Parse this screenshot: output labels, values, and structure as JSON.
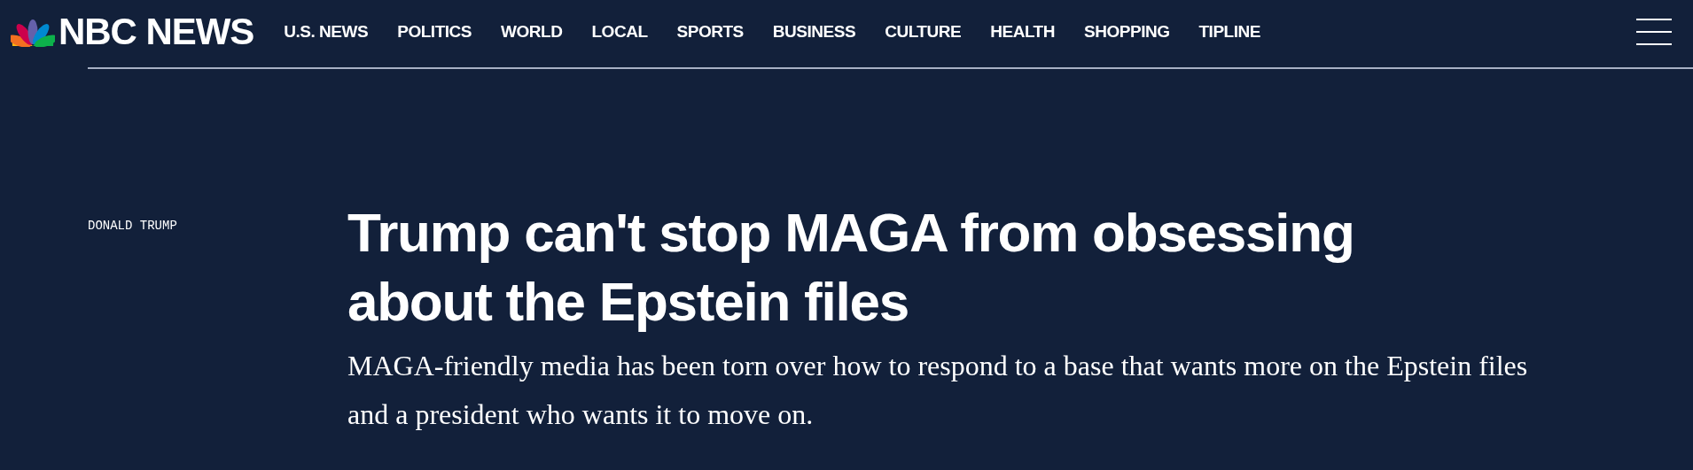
{
  "header": {
    "logo_text": "NBC NEWS",
    "nav": [
      "U.S. NEWS",
      "POLITICS",
      "WORLD",
      "LOCAL",
      "SPORTS",
      "BUSINESS",
      "CULTURE",
      "HEALTH",
      "SHOPPING",
      "TIPLINE"
    ]
  },
  "article": {
    "label": "DONALD TRUMP",
    "headline": "Trump can't stop MAGA from obsessing about the Epstein files",
    "dek": "MAGA-friendly media has been torn over how to respond to a base that wants more on the Epstein files and a president who wants it to move on."
  }
}
